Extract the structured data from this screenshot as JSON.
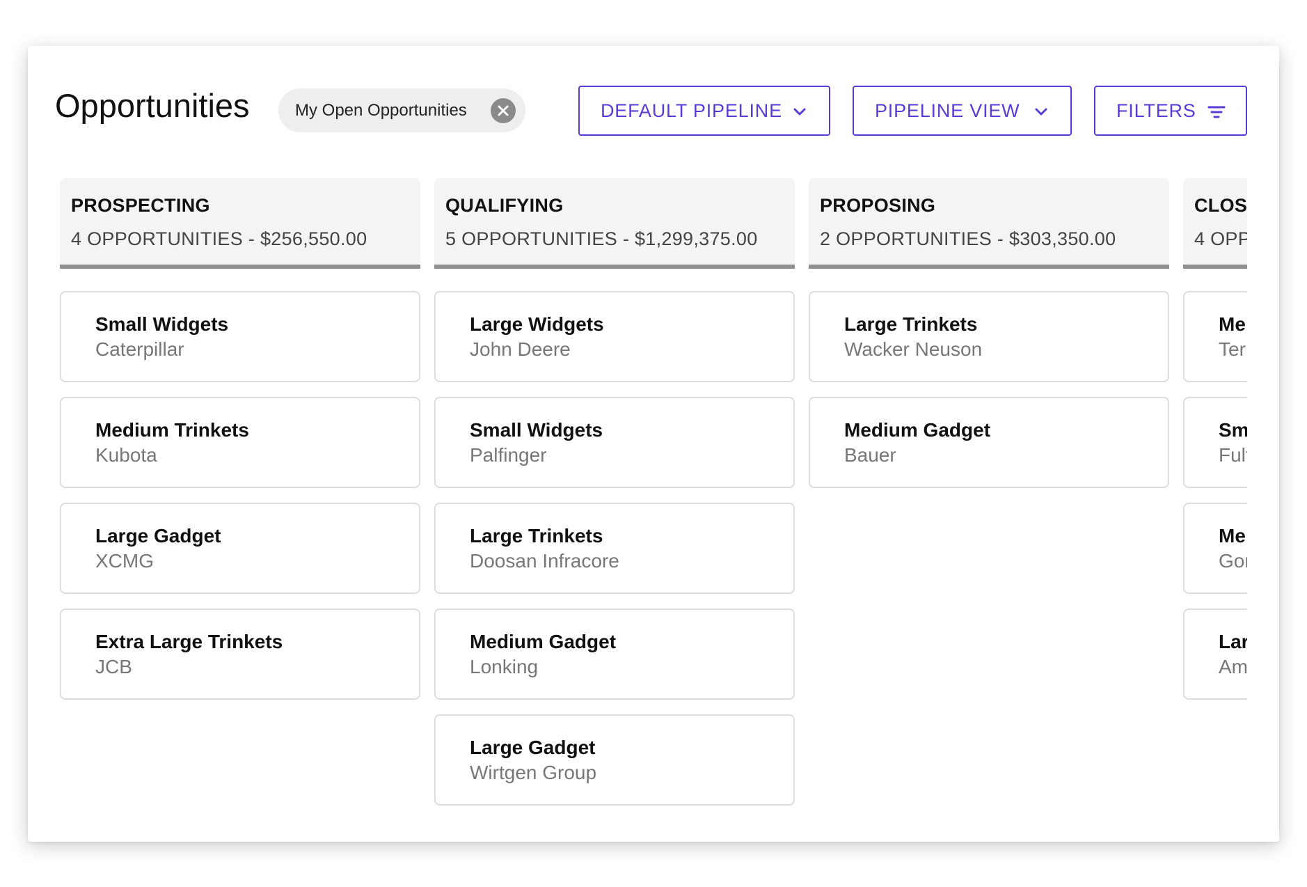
{
  "page": {
    "title": "Opportunities"
  },
  "filter_chip": {
    "label": "My Open Opportunities",
    "close_icon": "close-circle-icon"
  },
  "toolbar": {
    "pipeline_label": "DEFAULT PIPELINE",
    "view_label": "PIPELINE VIEW",
    "filters_label": "FILTERS"
  },
  "colors": {
    "accent": "#5b3bd6",
    "column_header_bg": "#f4f4f4",
    "column_divider": "#909090",
    "card_border": "#dddddd",
    "company_text": "#777777"
  },
  "columns": [
    {
      "title": "PROSPECTING",
      "summary": "4 OPPORTUNITIES - $256,550.00",
      "cards": [
        {
          "name": "Small Widgets",
          "company": "Caterpillar"
        },
        {
          "name": "Medium Trinkets",
          "company": "Kubota"
        },
        {
          "name": "Large Gadget",
          "company": "XCMG"
        },
        {
          "name": "Extra Large Trinkets",
          "company": "JCB"
        }
      ]
    },
    {
      "title": "QUALIFYING",
      "summary": "5 OPPORTUNITIES - $1,299,375.00",
      "cards": [
        {
          "name": "Large Widgets",
          "company": "John Deere"
        },
        {
          "name": "Small Widgets",
          "company": "Palfinger"
        },
        {
          "name": "Large Trinkets",
          "company": "Doosan Infracore"
        },
        {
          "name": "Medium Gadget",
          "company": "Lonking"
        },
        {
          "name": "Large Gadget",
          "company": "Wirtgen Group"
        }
      ]
    },
    {
      "title": "PROPOSING",
      "summary": "2 OPPORTUNITIES - $303,350.00",
      "cards": [
        {
          "name": "Large Trinkets",
          "company": "Wacker Neuson"
        },
        {
          "name": "Medium Gadget",
          "company": "Bauer"
        }
      ]
    },
    {
      "title": "CLOSI",
      "summary": "4 OPP",
      "cards": [
        {
          "name": "Me",
          "company": "Ter"
        },
        {
          "name": "Sm",
          "company": "Fult"
        },
        {
          "name": "Me",
          "company": "Gor"
        },
        {
          "name": "Lar",
          "company": "Am"
        }
      ]
    }
  ]
}
